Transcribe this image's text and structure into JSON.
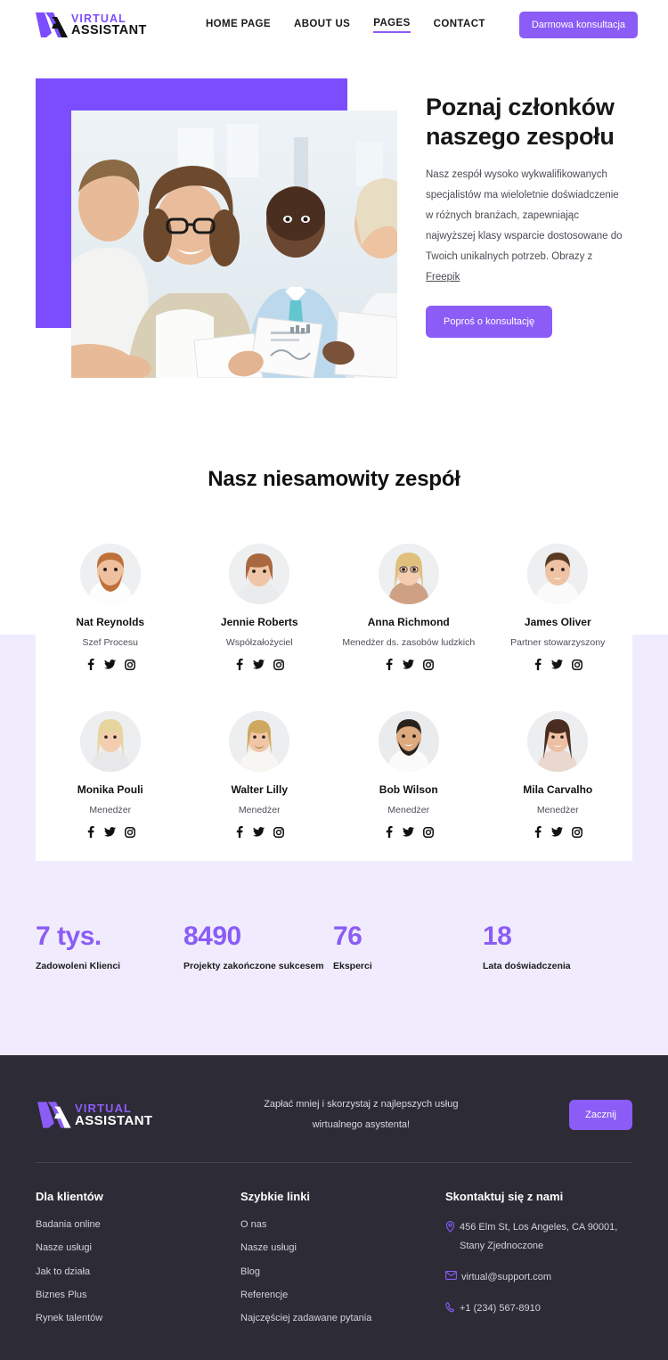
{
  "brand": {
    "logo_top": "VIRTUAL",
    "logo_bottom": "ASSISTANT",
    "accent_color": "#8b5cf6",
    "hero_block_color": "#7c4dff",
    "band_color": "#f0ecfd",
    "footer_color": "#2c2b36"
  },
  "header": {
    "nav": [
      {
        "label": "HOME PAGE",
        "active": false
      },
      {
        "label": "ABOUT US",
        "active": false
      },
      {
        "label": "PAGES",
        "active": true
      },
      {
        "label": "CONTACT",
        "active": false
      }
    ],
    "cta_label": "Darmowa konsultacja"
  },
  "hero": {
    "title": "Poznaj członków naszego zespołu",
    "description": "Nasz zespół wysoko wykwalifikowanych specjalistów ma wieloletnie doświadczenie w różnych branżach, zapewniając najwyższej klasy wsparcie dostosowane do Twoich unikalnych potrzeb. Obrazy z ",
    "description_link": "Freepik",
    "button_label": "Poproś o konsultację",
    "image_alt": "business-team-meeting-photo"
  },
  "team": {
    "title": "Nasz niesamowity zespół",
    "social_labels": [
      "facebook",
      "twitter",
      "instagram"
    ],
    "members": [
      {
        "name": "Nat Reynolds",
        "role": "Szef Procesu"
      },
      {
        "name": "Jennie Roberts",
        "role": "Współzałożyciel"
      },
      {
        "name": "Anna Richmond",
        "role": "Menedżer ds. zasobów ludzkich"
      },
      {
        "name": "James Oliver",
        "role": "Partner stowarzyszony"
      },
      {
        "name": "Monika Pouli",
        "role": "Menedżer"
      },
      {
        "name": "Walter Lilly",
        "role": "Menedżer"
      },
      {
        "name": "Bob Wilson",
        "role": "Menedżer"
      },
      {
        "name": "Mila Carvalho",
        "role": "Menedżer"
      }
    ]
  },
  "stats": [
    {
      "value": "7 tys.",
      "label": "Zadowoleni Klienci"
    },
    {
      "value": "8490",
      "label": "Projekty zakończone sukcesem"
    },
    {
      "value": "76",
      "label": "Eksperci"
    },
    {
      "value": "18",
      "label": "Lata doświadczenia"
    }
  ],
  "footer": {
    "tagline": "Zapłać mniej i skorzystaj z najlepszych usług wirtualnego asystenta!",
    "button_label": "Zacznij",
    "columns": [
      {
        "title": "Dla klientów",
        "links": [
          "Badania online",
          "Nasze usługi",
          "Jak to działa",
          "Biznes Plus",
          "Rynek talentów"
        ]
      },
      {
        "title": "Szybkie linki",
        "links": [
          "O nas",
          "Nasze usługi",
          "Blog",
          "Referencje",
          "Najczęściej zadawane pytania"
        ]
      }
    ],
    "contact": {
      "title": "Skontaktuj się z nami",
      "address": "456 Elm St, Los Angeles, CA 90001, Stany Zjednoczone",
      "email": "virtual@support.com",
      "phone": "+1 (234) 567-8910"
    }
  }
}
